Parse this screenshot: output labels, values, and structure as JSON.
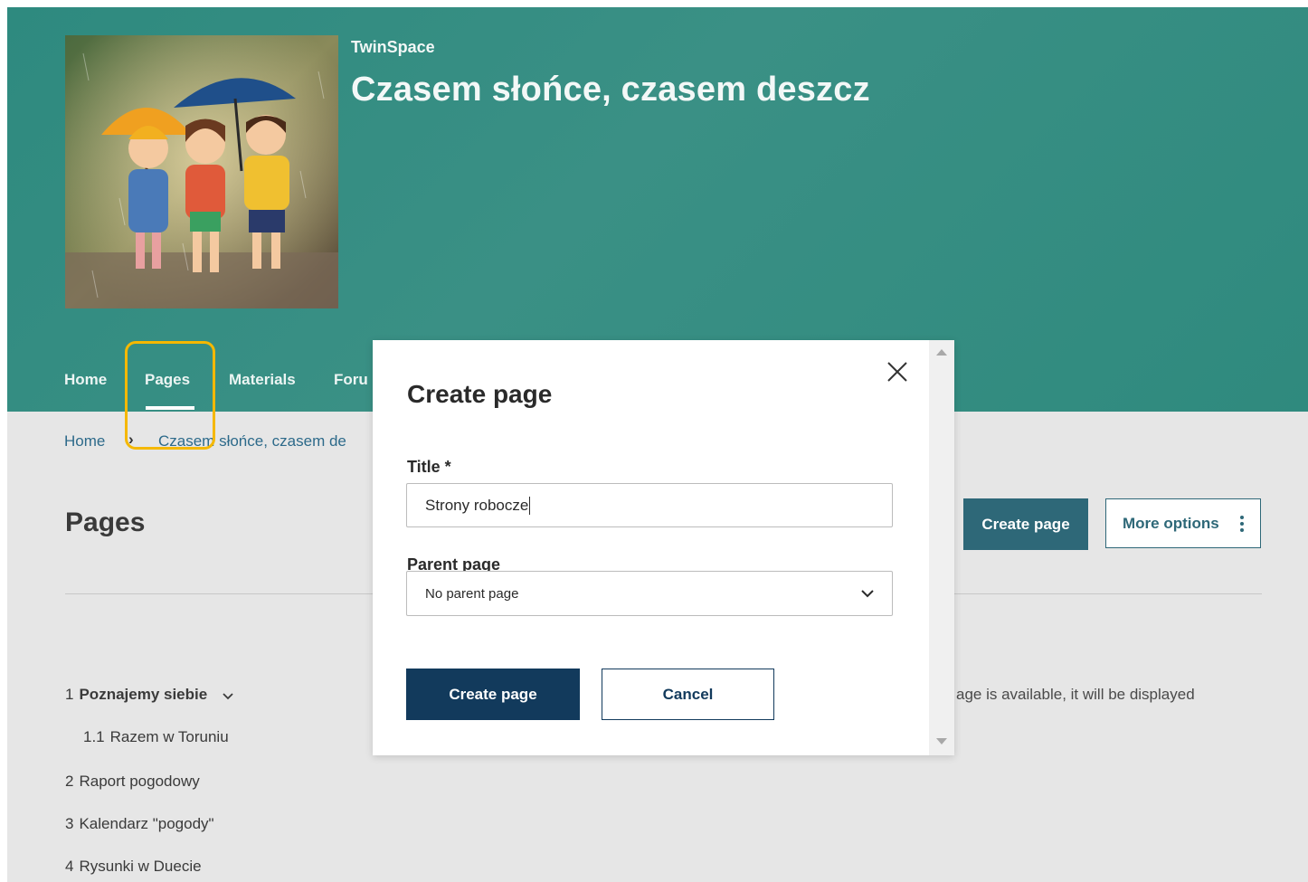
{
  "header": {
    "site_label": "TwinSpace",
    "title": "Czasem słońce, czasem deszcz"
  },
  "nav": {
    "items": [
      "Home",
      "Pages",
      "Materials",
      "Foru"
    ],
    "active": "Pages"
  },
  "breadcrumb": {
    "home": "Home",
    "separator": "›",
    "current": "Czasem słońce, czasem de"
  },
  "page": {
    "heading": "Pages",
    "create_button": "Create page",
    "more_options_button": "More options",
    "right_note": "age is available, it will be displayed"
  },
  "tree": {
    "items": [
      {
        "num": "1",
        "label": "Poznajemy siebie"
      },
      {
        "num": "1.1",
        "label": "Razem w Toruniu"
      },
      {
        "num": "2",
        "label": "Raport pogodowy"
      },
      {
        "num": "3",
        "label": "Kalendarz \"pogody\""
      },
      {
        "num": "4",
        "label": "Rysunki w Duecie"
      }
    ]
  },
  "modal": {
    "title": "Create page",
    "title_field_label": "Title *",
    "title_field_value": "Strony robocze",
    "parent_field_label": "Parent page",
    "parent_field_value": "No parent page",
    "create_button": "Create page",
    "cancel_button": "Cancel"
  },
  "colors": {
    "hero": "#3a9085",
    "primary_button": "#123a5c",
    "secondary_button": "#2e6878",
    "highlight": "#f5b800"
  }
}
